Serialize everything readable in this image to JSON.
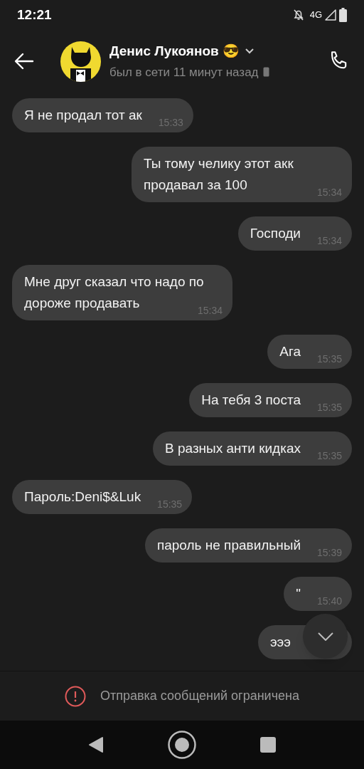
{
  "status_bar": {
    "time": "12:21",
    "network": "4G"
  },
  "header": {
    "name": "Денис Лукоянов 😎",
    "status": "был в сети 11 минут назад"
  },
  "messages": [
    {
      "kind": "incoming",
      "text": "Я не продал тот ак",
      "time": "15:33"
    },
    {
      "kind": "outgoing",
      "text": "Ты тому челику этот акк продавал за 100",
      "time": "15:34"
    },
    {
      "kind": "outgoing",
      "text": "Господи",
      "time": "15:34"
    },
    {
      "kind": "incoming",
      "text": "Мне друг сказал что надо по дороже продавать",
      "time": "15:34"
    },
    {
      "kind": "outgoing",
      "text": "Ага",
      "time": "15:35"
    },
    {
      "kind": "outgoing",
      "text": "На тебя 3 поста",
      "time": "15:35"
    },
    {
      "kind": "outgoing",
      "text": "В разных анти кидках",
      "time": "15:35"
    },
    {
      "kind": "incoming",
      "text": "Пароль:Deni$&Luk",
      "time": "15:35"
    },
    {
      "kind": "outgoing",
      "text": "пароль не правильный",
      "time": "15:39"
    },
    {
      "kind": "outgoing",
      "text": "\"",
      "time": "15:40"
    },
    {
      "kind": "outgoing",
      "text": "эээ"
    }
  ],
  "footer": {
    "notice": "Отправка сообщений ограничена"
  }
}
